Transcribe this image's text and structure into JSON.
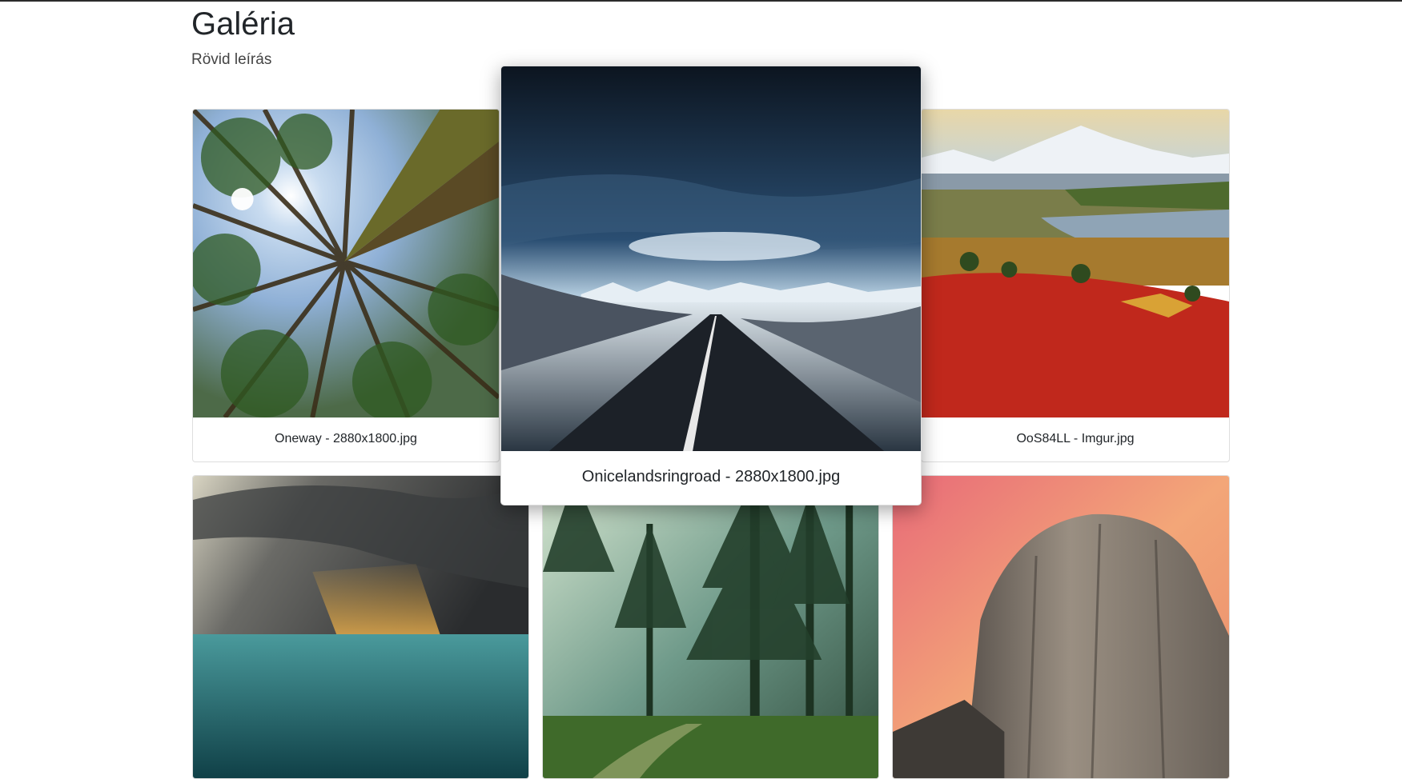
{
  "header": {
    "title": "Galéria",
    "subtitle": "Rövid leírás"
  },
  "gallery": {
    "items": [
      {
        "caption": "Oneway - 2880x1800.jpg",
        "image": "forest-canopy-looking-up"
      },
      {
        "caption": "Onicelandsringroad - 2880x1800.jpg",
        "image": "iceland-road-under-stormy-sky",
        "state": "zoomed"
      },
      {
        "caption": "OoS84LL - Imgur.jpg",
        "image": "alaska-mountain-lake-autumn"
      },
      {
        "caption": "",
        "image": "storm-clouds-over-sea"
      },
      {
        "caption": "",
        "image": "misty-forest-sunbeams"
      },
      {
        "caption": "",
        "image": "half-dome-sunset"
      }
    ]
  },
  "colors": {
    "accent": "#212529",
    "card_border": "#dcdcdc"
  }
}
